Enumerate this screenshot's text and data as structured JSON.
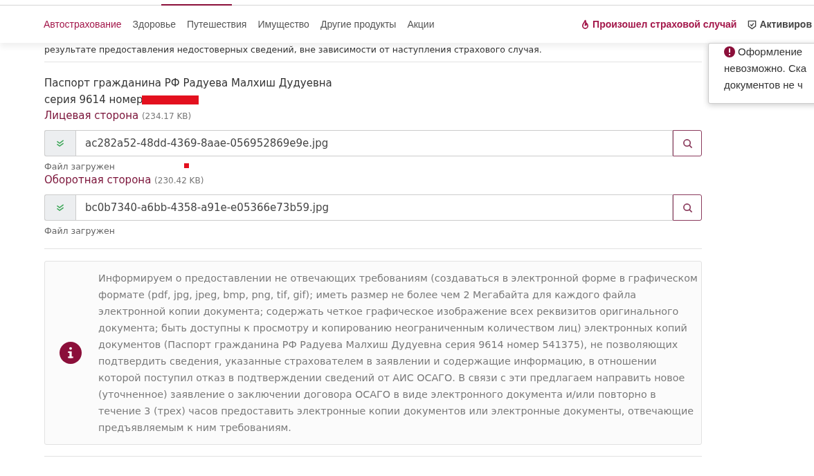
{
  "nav": {
    "items": [
      {
        "label": "Автострахование",
        "selected": true
      },
      {
        "label": "Здоровье",
        "selected": false
      },
      {
        "label": "Путешествия",
        "selected": false
      },
      {
        "label": "Имущество",
        "selected": false
      },
      {
        "label": "Другие продукты",
        "selected": false
      },
      {
        "label": "Акции",
        "selected": false
      }
    ],
    "actions": [
      {
        "kind": "incident",
        "label": "Произошел страховой случай"
      },
      {
        "kind": "activate",
        "label": "Активиров"
      }
    ]
  },
  "notice_popup": {
    "lines": [
      "Оформление",
      "невозможно. Ска",
      "документов не ч"
    ]
  },
  "intro_text": "результате предоставления недостоверных сведений, вне зависимости от наступления страхового случая.",
  "document": {
    "title_lines": [
      "Паспорт гражданина РФ Радуева Малхиш Дудуевна",
      "серия 9614 номер"
    ],
    "files": [
      {
        "label": "Лицевая сторона",
        "size": "(234.17 KB)",
        "filename": "ac282a52-48dd-4369-8aae-056952869e9e.jpg",
        "status": "Файл загружен"
      },
      {
        "label": "Оборотная сторона",
        "size": "(230.42 KB)",
        "filename": "bc0b7340-a6bb-4358-a91e-e05366e73b59.jpg",
        "status": "Файл загружен"
      }
    ]
  },
  "info_box": {
    "text": "Информируем о предоставлении не отвечающих требованиям (создаваться в электронной форме в графическом формате (pdf, jpg, jpeg, bmp, png, tif, gif); иметь размер не более чем 2 Мегабайта для каждого файла электронной копии документа; содержать четкое графическое изображение всех реквизитов оригинального документа; быть доступны к просмотру и копированию неограниченным количеством лиц) электронных копий документов (Паспорт гражданина РФ Радуева Малхиш Дудуевна серия 9614 номер 541375), не позволяющих подтвердить сведения, указанные страхователем в заявлении и содержащие информацию, в отношении которой поступил отказ в подтверждении сведений от АИС ОСАГО. В связи с эти предлагаем направить новое (уточненное) заявление о заключении договора ОСАГО в виде электронного документа и/или повторно в течение 3 (трех) часов предоставить электронные копии документов или электронные документы, отвечающие предъявляемым к ним требованиям."
  }
}
